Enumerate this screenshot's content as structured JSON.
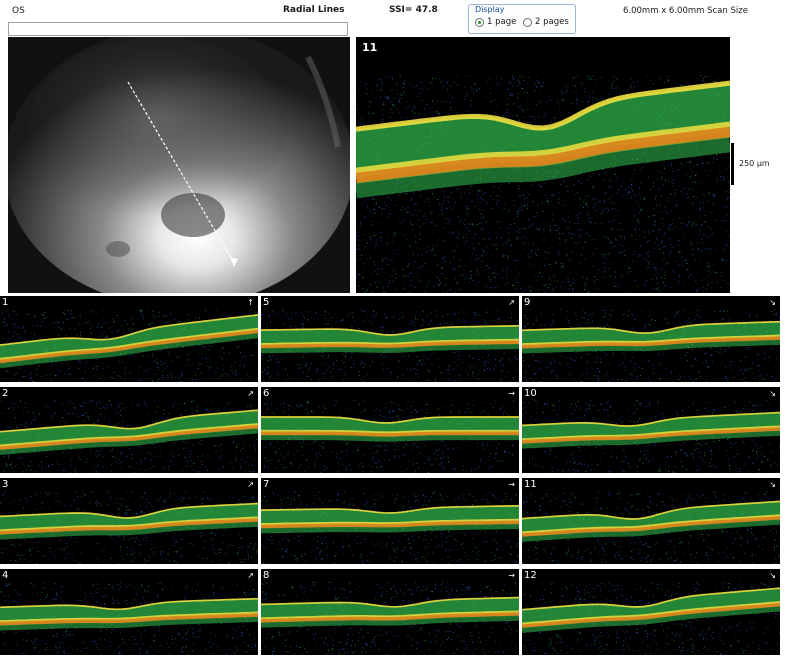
{
  "header": {
    "eye": "OS",
    "protocol": "Radial Lines",
    "ssi": "SSI= 47.8",
    "scan_size": "6.00mm x 6.00mm Scan Size"
  },
  "display": {
    "title": "Display",
    "options": [
      "1 page",
      "2 pages"
    ],
    "selected": "1 page"
  },
  "large_scan": {
    "number": "11",
    "scale": "250 µm"
  },
  "thumbnails": [
    "1",
    "2",
    "3",
    "4",
    "5",
    "6",
    "7",
    "8",
    "9",
    "10",
    "11",
    "12"
  ],
  "colors": {
    "retina_green": "#2fb34a",
    "rpe_orange": "#e08a1e",
    "rpe_yellow": "#f0e040",
    "noise_blue": "#2e5fd0"
  }
}
